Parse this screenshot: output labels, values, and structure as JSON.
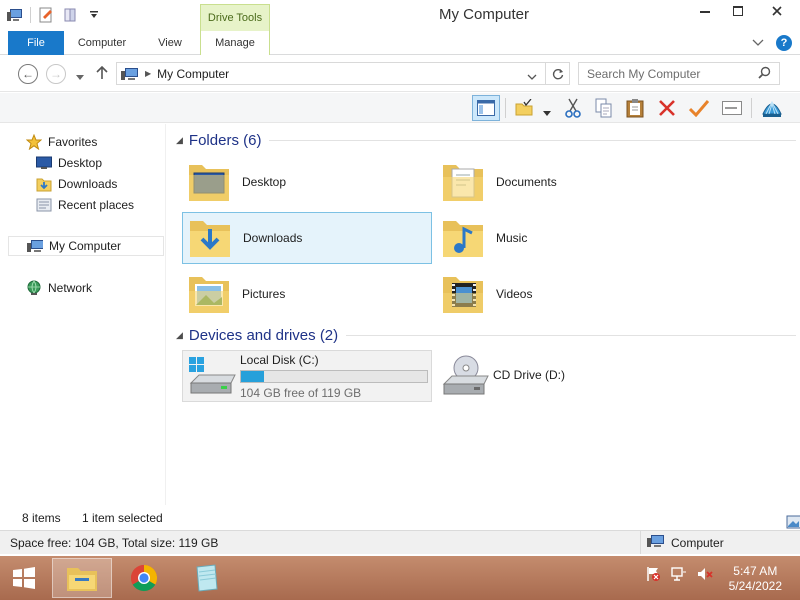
{
  "window": {
    "title": "My Computer",
    "contextual_tab_group": "Drive Tools"
  },
  "ribbon": {
    "tabs": [
      "File",
      "Computer",
      "View",
      "Manage"
    ]
  },
  "navigation": {
    "address": "My Computer",
    "search_placeholder": "Search My Computer"
  },
  "sidebar": {
    "items": [
      {
        "label": "Favorites",
        "icon": "star-icon"
      },
      {
        "label": "Desktop",
        "icon": "desktop-icon"
      },
      {
        "label": "Downloads",
        "icon": "downloads-icon"
      },
      {
        "label": "Recent places",
        "icon": "recent-places-icon"
      },
      {
        "label": "My Computer",
        "icon": "computer-icon",
        "selected": true
      },
      {
        "label": "Network",
        "icon": "network-icon"
      }
    ]
  },
  "content": {
    "folders_header": "Folders (6)",
    "folders": [
      {
        "label": "Desktop",
        "icon": "desktop-folder-icon"
      },
      {
        "label": "Documents",
        "icon": "documents-folder-icon"
      },
      {
        "label": "Downloads",
        "icon": "downloads-folder-icon",
        "selected": true
      },
      {
        "label": "Music",
        "icon": "music-folder-icon"
      },
      {
        "label": "Pictures",
        "icon": "pictures-folder-icon"
      },
      {
        "label": "Videos",
        "icon": "videos-folder-icon"
      }
    ],
    "drives_header": "Devices and drives (2)",
    "drives": [
      {
        "label": "Local Disk (C:)",
        "free_text": "104 GB free of 119 GB",
        "used_fraction": 0.126,
        "selected": true,
        "icon": "local-disk-icon"
      },
      {
        "label": "CD Drive (D:)",
        "icon": "cd-drive-icon"
      }
    ]
  },
  "status": {
    "item_count": "8 items",
    "selection": "1 item selected"
  },
  "details": {
    "space": "Space free: 104 GB, Total size: 119 GB",
    "location": "Computer"
  },
  "taskbar": {
    "apps": [
      "file-explorer-icon",
      "chrome-icon",
      "notepad-icon"
    ],
    "time": "5:47 AM",
    "date": "5/24/2022"
  },
  "colors": {
    "accent": "#1979ca",
    "header_text": "#1e3287",
    "selection_bg": "#e5f3fb",
    "taskbar": "#b27a5e"
  }
}
